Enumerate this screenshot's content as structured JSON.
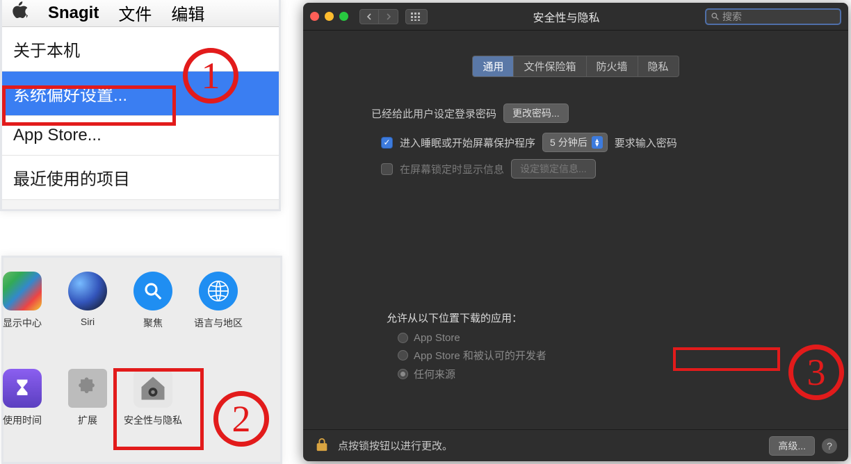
{
  "annotations": {
    "one": "1",
    "two": "2",
    "three": "3"
  },
  "panel1": {
    "menubar": {
      "appname": "Snagit",
      "file": "文件",
      "edit": "编辑"
    },
    "menu": {
      "about": "关于本机",
      "sysprefs": "系统偏好设置...",
      "appstore": "App Store...",
      "recent": "最近使用的项目"
    }
  },
  "panel2": {
    "items": [
      {
        "label": "显示中心",
        "icon": "ic-display"
      },
      {
        "label": "Siri",
        "icon": "ic-siri"
      },
      {
        "label": "聚焦",
        "icon": "ic-spotlight"
      },
      {
        "label": "语言与地区",
        "icon": "ic-language"
      },
      {
        "label": "使用时间",
        "icon": "ic-screentime"
      },
      {
        "label": "扩展",
        "icon": "ic-extension"
      },
      {
        "label": "安全性与隐私",
        "icon": "ic-security"
      }
    ]
  },
  "panel3": {
    "title": "安全性与隐私",
    "search_placeholder": "搜索",
    "tabs": {
      "general": "通用",
      "filevault": "文件保险箱",
      "firewall": "防火墙",
      "privacy": "隐私"
    },
    "login_set": "已经给此用户设定登录密码",
    "change_pw": "更改密码...",
    "require_pw_label": "进入睡眠或开始屏幕保护程序",
    "require_pw_after_value": "5 分钟后",
    "require_pw_tail": "要求输入密码",
    "show_lock_msg": "在屏幕锁定时显示信息",
    "set_lock_msg": "设定锁定信息...",
    "allow_title": "允许从以下位置下载的应用：",
    "opt_appstore": "App Store",
    "opt_identified": "App Store 和被认可的开发者",
    "opt_anywhere": "任何来源",
    "footer_text": "点按锁按钮以进行更改。",
    "advanced": "高级...",
    "help": "?"
  }
}
